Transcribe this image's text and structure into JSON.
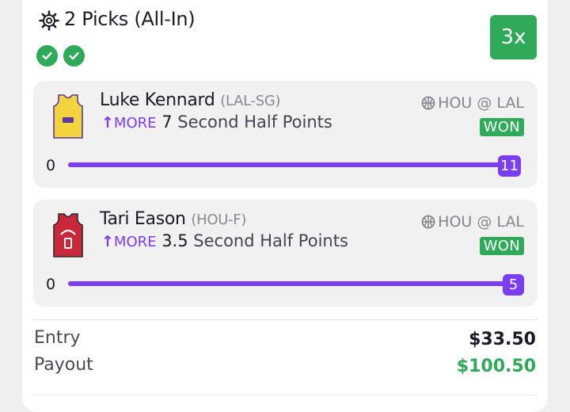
{
  "header": {
    "title": "2 Picks (All-In)",
    "multiplier": "3x"
  },
  "picks": [
    {
      "player": "Luke Kennard",
      "position": "(LAL-SG)",
      "direction": "MORE",
      "line": "7",
      "stat": "Second Half Points",
      "game": "HOU @ LAL",
      "status": "WON",
      "min": "0",
      "result": "11",
      "progress": 1.0,
      "jersey_color": "#f3d33e"
    },
    {
      "player": "Tari Eason",
      "position": "(HOU-F)",
      "direction": "MORE",
      "line": "3.5",
      "stat": "Second Half Points",
      "game": "HOU @ LAL",
      "status": "WON",
      "min": "0",
      "result": "5",
      "progress": 1.0,
      "jersey_color": "#c8283a"
    }
  ],
  "summary": {
    "entry_label": "Entry",
    "entry_value": "$33.50",
    "payout_label": "Payout",
    "payout_value": "$100.50"
  },
  "colors": {
    "accent": "#7a3df0",
    "success": "#2eaa58"
  },
  "icons": [
    "settings-icon",
    "check-icon",
    "jersey-icon",
    "basketball-icon",
    "arrow-up-icon"
  ]
}
